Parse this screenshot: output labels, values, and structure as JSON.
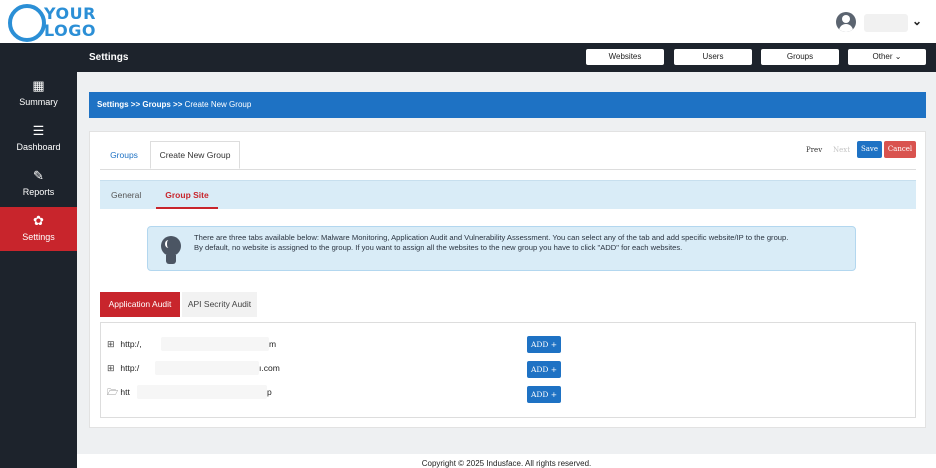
{
  "logo": {
    "line1": "YOUR",
    "line2": "LOGO",
    "color": "#2b8fd6"
  },
  "user": {
    "caret": "⌄"
  },
  "titlebar": {
    "title": "Settings"
  },
  "topnav": [
    {
      "label": "Websites"
    },
    {
      "label": "Users"
    },
    {
      "label": "Groups"
    },
    {
      "label": "Other  ⌄"
    }
  ],
  "sidebar": {
    "items": [
      {
        "label": "Summary",
        "icon": "summary-icon",
        "glyph": "▦",
        "active": false
      },
      {
        "label": "Dashboard",
        "icon": "dashboard-icon",
        "glyph": "☰",
        "active": false
      },
      {
        "label": "Reports",
        "icon": "reports-icon",
        "glyph": "✎",
        "active": false
      },
      {
        "label": "Settings",
        "icon": "gear-icon",
        "glyph": "✿",
        "active": true
      }
    ]
  },
  "breadcrumb": {
    "path": "Settings >> Groups >> ",
    "current": "Create New Group"
  },
  "tabs": {
    "groups": "Groups",
    "create": "Create New Group"
  },
  "pager": {
    "prev": "Prev",
    "next": "Next",
    "save": "Save",
    "cancel": "Cancel"
  },
  "subtabs": {
    "general": "General",
    "group_site": "Group Site"
  },
  "info": {
    "line1": "There are three tabs available below: Malware Monitoring, Application Audit and Vulnerability Assessment. You can select any of the tab and add specific website/IP to the group.",
    "line2": "By default, no website is assigned to the group. If you want to assign all the websites to the new group you have to click \"ADD\" for each websites."
  },
  "audit_tabs": {
    "application": "Application Audit",
    "api": "API Secrity Audit"
  },
  "sites": [
    {
      "prefix": "http:/,",
      "suffix": "m",
      "icon": "plus-square-icon",
      "glyph": "⊞",
      "add_label": "ADD +"
    },
    {
      "prefix": "http:/",
      "suffix": "ı.com",
      "icon": "plus-square-icon",
      "glyph": "⊞",
      "add_label": "ADD +"
    },
    {
      "prefix": "htt",
      "suffix": "p",
      "icon": "folder-open-icon",
      "glyph": "🗁",
      "add_label": "ADD +"
    }
  ],
  "footer": {
    "copyright": "Copyright © 2025 Indusface. All rights reserved."
  },
  "colors": {
    "dark": "#1d232c",
    "accent_red": "#c8252c",
    "accent_blue": "#1e72c4",
    "info_bg": "#d9ecf7"
  }
}
